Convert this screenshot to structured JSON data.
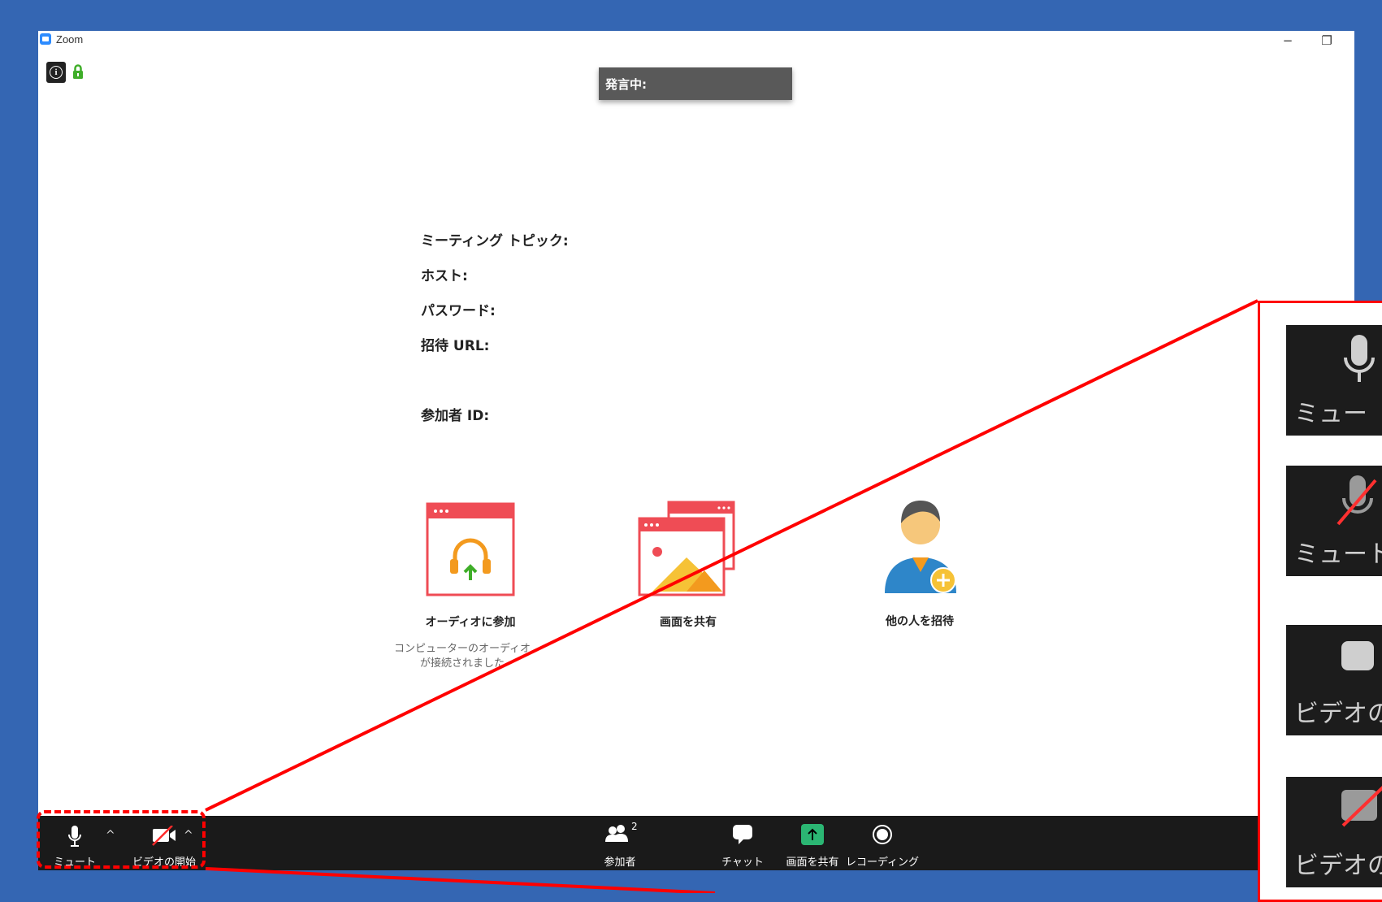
{
  "window": {
    "title": "Zoom"
  },
  "window_controls": {
    "minimize": "−",
    "restore": "❐",
    "close": "✕"
  },
  "speaking_banner": {
    "label": "発言中:"
  },
  "meeting_info": {
    "topic_label": "ミーティング トピック:",
    "host_label": "ホスト:",
    "password_label": "パスワード:",
    "invite_url_label": "招待 URL:",
    "participant_id_label": "参加者 ID:"
  },
  "actions": {
    "join_audio": {
      "label": "オーディオに参加",
      "sub": "コンピューターのオーディオが接続されました"
    },
    "share_screen": {
      "label": "画面を共有"
    },
    "invite": {
      "label": "他の人を招待"
    }
  },
  "toolbar": {
    "mute_label": "ミュート",
    "video_label": "ビデオの開始",
    "participants_label": "参加者",
    "participants_count": "2",
    "chat_label": "チャット",
    "share_label": "画面を共有",
    "record_label": "レコーディング",
    "caret": "^"
  },
  "zoomed_panel": {
    "tiles": [
      {
        "label": "ミュー"
      },
      {
        "label": "ミュート"
      },
      {
        "label": "ビデオの"
      },
      {
        "label": "ビデオの"
      }
    ]
  },
  "colors": {
    "background": "#3466b3",
    "toolbar": "#1a1a1a",
    "annotation_red": "#ff0000",
    "share_green": "#2bb673",
    "lock_green": "#3fae29"
  },
  "icons": {
    "mic": "microphone-icon",
    "video_off": "video-off-icon",
    "participants": "participants-icon",
    "chat": "chat-bubble-icon",
    "share": "share-screen-icon",
    "record": "record-icon",
    "lock": "lock-icon",
    "info": "info-icon"
  }
}
